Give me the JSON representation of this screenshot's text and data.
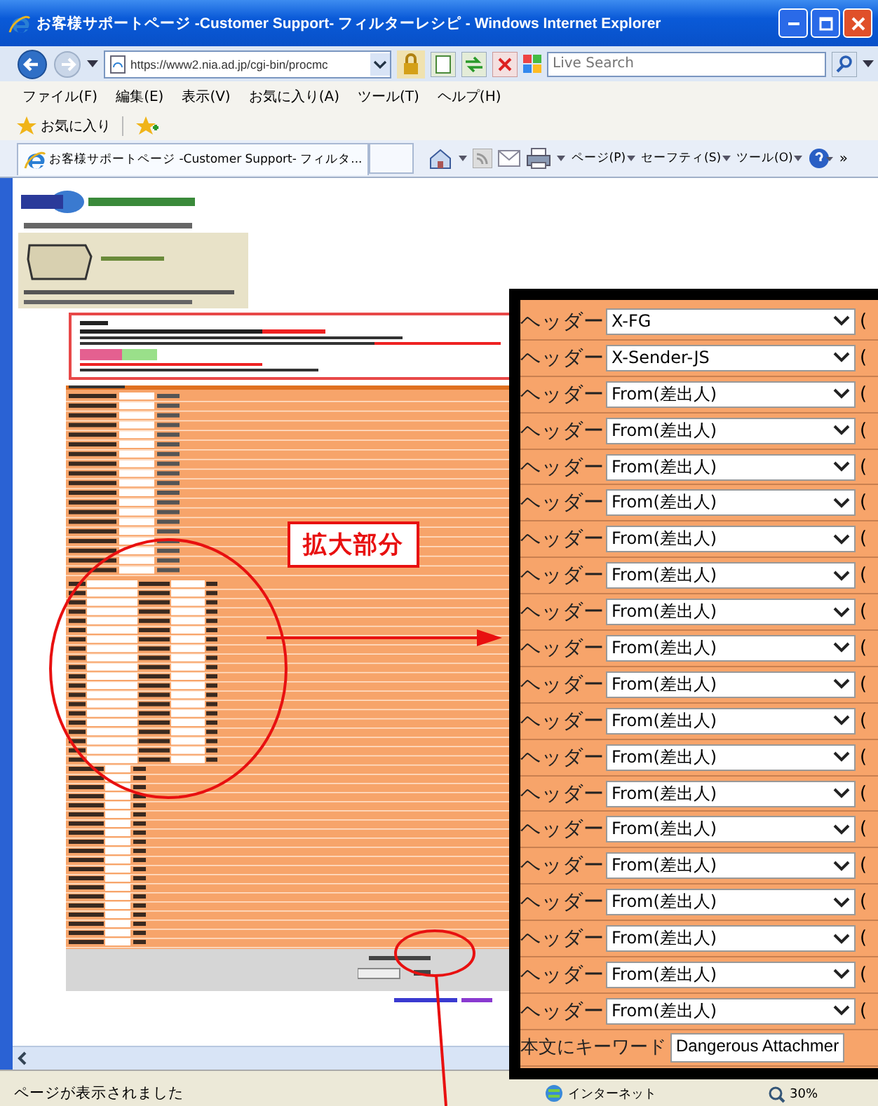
{
  "window": {
    "title": "お客様サポートページ -Customer Support- フィルターレシピ - Windows Internet Explorer"
  },
  "address_bar": {
    "url": "https://www2.nia.ad.jp/cgi-bin/procmc"
  },
  "search": {
    "placeholder": "Live Search"
  },
  "menu": [
    "ファイル(F)",
    "編集(E)",
    "表示(V)",
    "お気に入り(A)",
    "ツール(T)",
    "ヘルプ(H)"
  ],
  "favorites_bar": {
    "label": "お気に入り"
  },
  "tabs": [
    {
      "label": "お客様サポートページ -Customer Support- フィルタ...",
      "selected": true
    }
  ],
  "command_bar": {
    "items": [
      "ページ(P)",
      "セーフティ(S)",
      "ツール(O)"
    ],
    "overflow": "»"
  },
  "callout": {
    "label": "拡大部分"
  },
  "magnified": {
    "header_rows": [
      {
        "label": "ヘッダー",
        "value": "X-FG",
        "column_3": "("
      },
      {
        "label": "ヘッダー",
        "value": "X-Sender-JS",
        "column_3": "("
      },
      {
        "label": "ヘッダー",
        "value": "From(差出人)",
        "column_3": "("
      },
      {
        "label": "ヘッダー",
        "value": "From(差出人)",
        "column_3": "("
      },
      {
        "label": "ヘッダー",
        "value": "From(差出人)",
        "column_3": "("
      },
      {
        "label": "ヘッダー",
        "value": "From(差出人)",
        "column_3": "("
      },
      {
        "label": "ヘッダー",
        "value": "From(差出人)",
        "column_3": "("
      },
      {
        "label": "ヘッダー",
        "value": "From(差出人)",
        "column_3": "("
      },
      {
        "label": "ヘッダー",
        "value": "From(差出人)",
        "column_3": "("
      },
      {
        "label": "ヘッダー",
        "value": "From(差出人)",
        "column_3": "("
      },
      {
        "label": "ヘッダー",
        "value": "From(差出人)",
        "column_3": "("
      },
      {
        "label": "ヘッダー",
        "value": "From(差出人)",
        "column_3": "("
      },
      {
        "label": "ヘッダー",
        "value": "From(差出人)",
        "column_3": "("
      },
      {
        "label": "ヘッダー",
        "value": "From(差出人)",
        "column_3": "("
      },
      {
        "label": "ヘッダー",
        "value": "From(差出人)",
        "column_3": "("
      },
      {
        "label": "ヘッダー",
        "value": "From(差出人)",
        "column_3": "("
      },
      {
        "label": "ヘッダー",
        "value": "From(差出人)",
        "column_3": "("
      },
      {
        "label": "ヘッダー",
        "value": "From(差出人)",
        "column_3": "("
      },
      {
        "label": "ヘッダー",
        "value": "From(差出人)",
        "column_3": "("
      },
      {
        "label": "ヘッダー",
        "value": "From(差出人)",
        "column_3": "("
      }
    ],
    "keyword_row": {
      "label": "本文にキーワード",
      "value": "Dangerous Attachmer"
    }
  },
  "status_bar": {
    "text": "ページが表示されました",
    "zone": "インターネット",
    "zoom": "30%"
  }
}
